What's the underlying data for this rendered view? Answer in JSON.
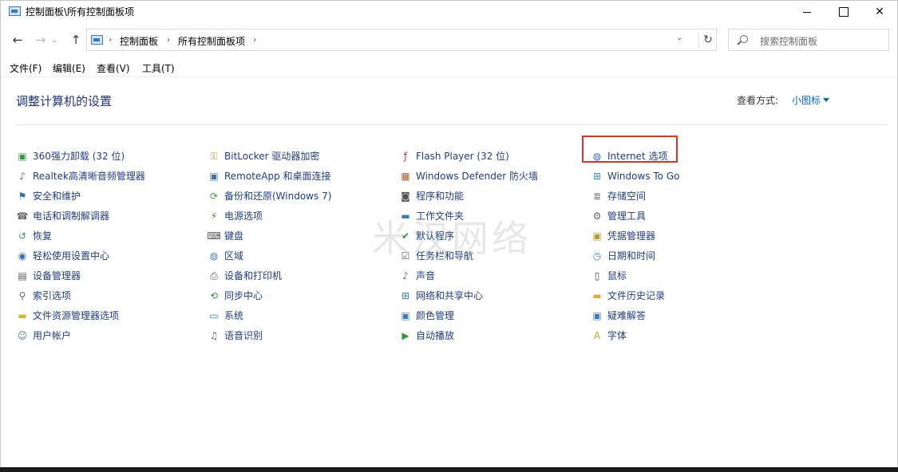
{
  "window": {
    "title": "控制面板\\所有控制面板项",
    "min_glyph": "",
    "close_glyph": "✕"
  },
  "nav": {
    "back": "←",
    "forward": "→",
    "recent": "⌄",
    "up": "↑",
    "breadcrumbs": [
      "控制面板",
      "所有控制面板项"
    ],
    "crumb_sep": "›",
    "dropdown": "⌄",
    "refresh": "↻"
  },
  "search": {
    "placeholder": "搜索控制面板"
  },
  "menu": [
    "文件(F)",
    "编辑(E)",
    "查看(V)",
    "工具(T)"
  ],
  "header": {
    "title": "调整计算机的设置",
    "view_by_label": "查看方式:",
    "view_by_value": "小图标"
  },
  "items": {
    "col1": [
      {
        "label": "360强力卸载 (32 位)",
        "icon": "uninstall-icon",
        "glyph": "▣",
        "color": "#3a9a3a"
      },
      {
        "label": "Realtek高清晰音频管理器",
        "icon": "audio-manager-icon",
        "glyph": "♪",
        "color": "#2f6fb3"
      },
      {
        "label": "安全和维护",
        "icon": "flag-icon",
        "glyph": "⚑",
        "color": "#2f6fb3"
      },
      {
        "label": "电话和调制解调器",
        "icon": "phone-modem-icon",
        "glyph": "☎",
        "color": "#666666"
      },
      {
        "label": "恢复",
        "icon": "recovery-icon",
        "glyph": "↺",
        "color": "#2e9a6a"
      },
      {
        "label": "轻松使用设置中心",
        "icon": "ease-of-access-icon",
        "glyph": "◉",
        "color": "#2f6fb3"
      },
      {
        "label": "设备管理器",
        "icon": "device-manager-icon",
        "glyph": "▤",
        "color": "#555555"
      },
      {
        "label": "索引选项",
        "icon": "indexing-icon",
        "glyph": "⚲",
        "color": "#666666"
      },
      {
        "label": "文件资源管理器选项",
        "icon": "folder-options-icon",
        "glyph": "▬",
        "color": "#e0b13a"
      },
      {
        "label": "用户帐户",
        "icon": "user-accounts-icon",
        "glyph": "☺",
        "color": "#4a7fb8"
      }
    ],
    "col2": [
      {
        "label": "BitLocker 驱动器加密",
        "icon": "bitlocker-icon",
        "glyph": "⚿",
        "color": "#b8962e"
      },
      {
        "label": "RemoteApp 和桌面连接",
        "icon": "remoteapp-icon",
        "glyph": "▣",
        "color": "#3a6fb0"
      },
      {
        "label": "备份和还原(Windows 7)",
        "icon": "backup-icon",
        "glyph": "⟳",
        "color": "#3a9a3a"
      },
      {
        "label": "电源选项",
        "icon": "power-icon",
        "glyph": "⚡",
        "color": "#3a8a3a"
      },
      {
        "label": "键盘",
        "icon": "keyboard-icon",
        "glyph": "⌨",
        "color": "#555555"
      },
      {
        "label": "区域",
        "icon": "region-icon",
        "glyph": "◍",
        "color": "#3a7ab8"
      },
      {
        "label": "设备和打印机",
        "icon": "printer-icon",
        "glyph": "⎙",
        "color": "#555555"
      },
      {
        "label": "同步中心",
        "icon": "sync-icon",
        "glyph": "⟲",
        "color": "#2e9a3a"
      },
      {
        "label": "系统",
        "icon": "system-icon",
        "glyph": "▭",
        "color": "#3a7ab8"
      },
      {
        "label": "语音识别",
        "icon": "microphone-icon",
        "glyph": "♫",
        "color": "#666666"
      }
    ],
    "col3": [
      {
        "label": "Flash Player (32 位)",
        "icon": "flash-icon",
        "glyph": "ƒ",
        "color": "#c0392b"
      },
      {
        "label": "Windows Defender 防火墙",
        "icon": "firewall-icon",
        "glyph": "▦",
        "color": "#b05a2e"
      },
      {
        "label": "程序和功能",
        "icon": "programs-icon",
        "glyph": "◙",
        "color": "#555555"
      },
      {
        "label": "工作文件夹",
        "icon": "work-folders-icon",
        "glyph": "▬",
        "color": "#3a7ab8"
      },
      {
        "label": "默认程序",
        "icon": "default-programs-icon",
        "glyph": "✔",
        "color": "#2e9a3a"
      },
      {
        "label": "任务栏和导航",
        "icon": "taskbar-icon",
        "glyph": "☑",
        "color": "#555555"
      },
      {
        "label": "声音",
        "icon": "speaker-icon",
        "glyph": "♪",
        "color": "#666666"
      },
      {
        "label": "网络和共享中心",
        "icon": "network-icon",
        "glyph": "⊞",
        "color": "#3a7ab8"
      },
      {
        "label": "颜色管理",
        "icon": "color-management-icon",
        "glyph": "▣",
        "color": "#3a7ab8"
      },
      {
        "label": "自动播放",
        "icon": "autoplay-icon",
        "glyph": "▶",
        "color": "#2e9a3a"
      }
    ],
    "col4": [
      {
        "label": "Internet 选项",
        "icon": "internet-options-icon",
        "glyph": "◍",
        "color": "#2f6fb3"
      },
      {
        "label": "Windows To Go",
        "icon": "windows-to-go-icon",
        "glyph": "⊞",
        "color": "#2f8ad8"
      },
      {
        "label": "存储空间",
        "icon": "storage-spaces-icon",
        "glyph": "≣",
        "color": "#666666"
      },
      {
        "label": "管理工具",
        "icon": "admin-tools-icon",
        "glyph": "⚙",
        "color": "#666666"
      },
      {
        "label": "凭据管理器",
        "icon": "credential-manager-icon",
        "glyph": "▣",
        "color": "#b8962e"
      },
      {
        "label": "日期和时间",
        "icon": "clock-icon",
        "glyph": "◷",
        "color": "#3a7ab8"
      },
      {
        "label": "鼠标",
        "icon": "mouse-icon",
        "glyph": "▯",
        "color": "#444444"
      },
      {
        "label": "文件历史记录",
        "icon": "file-history-icon",
        "glyph": "▬",
        "color": "#e0b13a"
      },
      {
        "label": "疑难解答",
        "icon": "troubleshooting-icon",
        "glyph": "▣",
        "color": "#3a7ab8"
      },
      {
        "label": "字体",
        "icon": "fonts-icon",
        "glyph": "A",
        "color": "#c8a020"
      }
    ]
  },
  "watermark": "米汉网络"
}
